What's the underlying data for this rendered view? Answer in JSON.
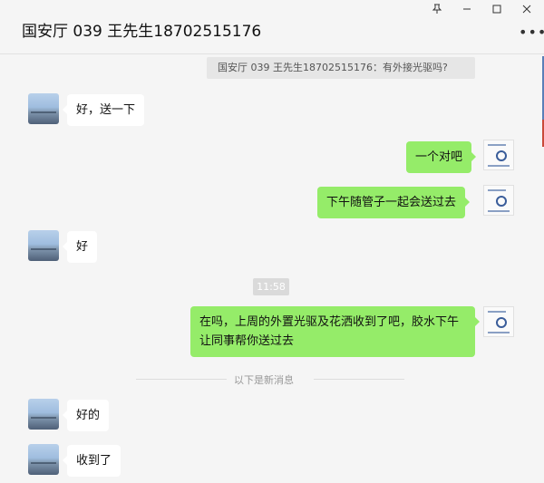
{
  "window": {
    "title": "国安厅 039 王先生18702515176",
    "pin_icon": "pin-icon",
    "minimize_icon": "minimize-icon",
    "maximize_icon": "maximize-icon",
    "close_icon": "close-icon",
    "more_icon": "more-options-icon"
  },
  "quote": {
    "text": "国安厅 039 王先生18702515176：有外接光驱吗?"
  },
  "messages": [
    {
      "side": "in",
      "text": "好，送一下"
    },
    {
      "side": "out",
      "text": "一个对吧"
    },
    {
      "side": "out",
      "text": "下午随管子一起会送过去"
    },
    {
      "side": "in",
      "text": "好"
    },
    {
      "side": "out",
      "text": "在吗，上周的外置光驱及花洒收到了吧，胶水下午让同事帮你送过去"
    },
    {
      "side": "in",
      "text": "好的"
    },
    {
      "side": "in",
      "text": "收到了"
    }
  ],
  "timestamp": "11:58",
  "new_messages_divider": "以下是新消息",
  "colors": {
    "outgoing_bubble": "#95ec69",
    "incoming_bubble": "#ffffff",
    "background": "#f5f5f5"
  }
}
